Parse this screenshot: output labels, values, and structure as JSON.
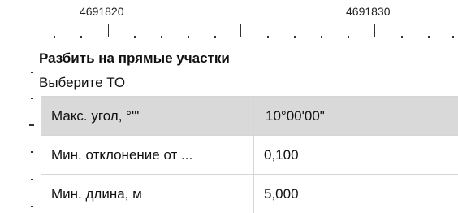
{
  "ruler": {
    "labels": [
      "4691820",
      "4691830"
    ]
  },
  "panel": {
    "title": "Разбить на прямые участки",
    "subtitle": "Выберите ТО"
  },
  "properties": [
    {
      "label": "Макс. угол, °'\"",
      "value": "10°00'00\""
    },
    {
      "label": "Мин. отклонение от ...",
      "value": "0,100"
    },
    {
      "label": "Мин. длина, м",
      "value": "5,000"
    }
  ],
  "selected_row": 0
}
